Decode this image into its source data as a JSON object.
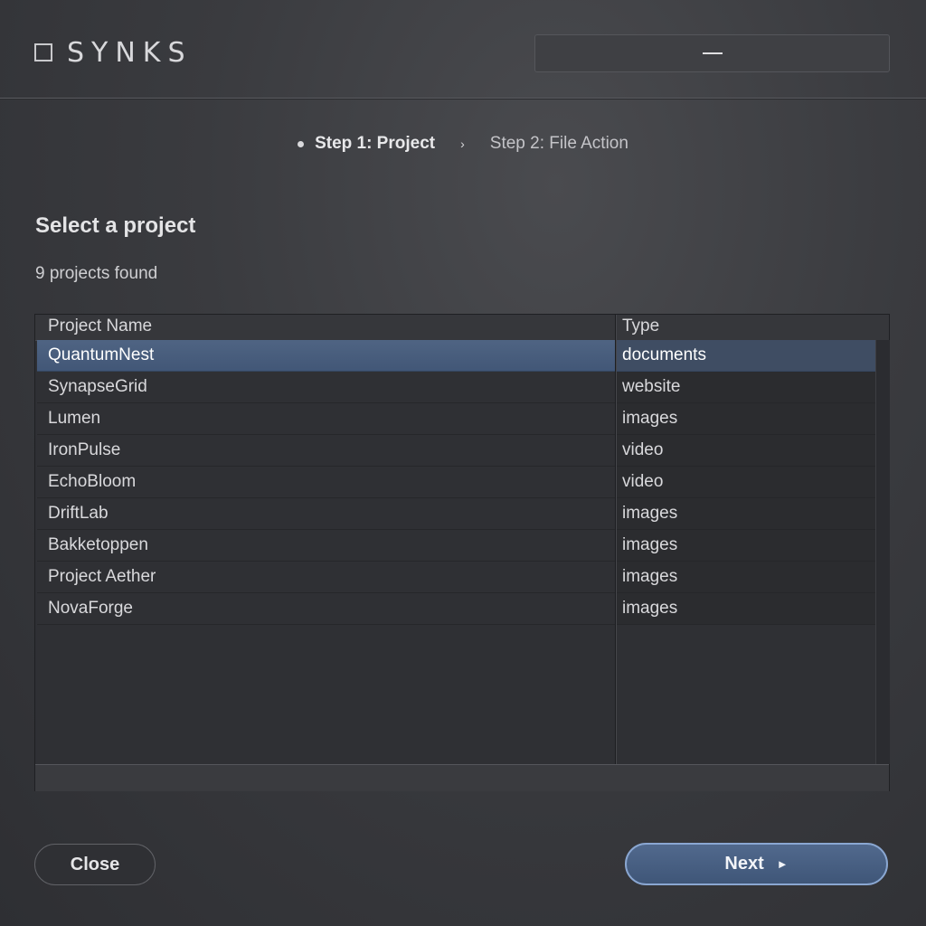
{
  "header": {
    "app_name": "SYNKS",
    "minimize_symbol": "—"
  },
  "steps": {
    "step1_label": "Step 1: Project",
    "separator": "›",
    "step2_label": "Step 2: File Action"
  },
  "main": {
    "title": "Select a project",
    "count_text": "9 projects found"
  },
  "table": {
    "columns": [
      "Project Name",
      "Type"
    ],
    "rows": [
      {
        "name": "QuantumNest",
        "type": "documents",
        "selected": true
      },
      {
        "name": "SynapseGrid",
        "type": "website",
        "selected": false
      },
      {
        "name": "Lumen",
        "type": "images",
        "selected": false
      },
      {
        "name": "IronPulse",
        "type": "video",
        "selected": false
      },
      {
        "name": "EchoBloom",
        "type": "video",
        "selected": false
      },
      {
        "name": "DriftLab",
        "type": "images",
        "selected": false
      },
      {
        "name": "Bakketoppen",
        "type": "images",
        "selected": false
      },
      {
        "name": "Project Aether",
        "type": "images",
        "selected": false
      },
      {
        "name": "NovaForge",
        "type": "images",
        "selected": false
      }
    ]
  },
  "footer": {
    "close_label": "Close",
    "next_label": "Next",
    "next_arrow": "►"
  },
  "colors": {
    "accent": "#4f6483",
    "next_border": "#8aa7d2",
    "background": "#3a3b3f"
  }
}
